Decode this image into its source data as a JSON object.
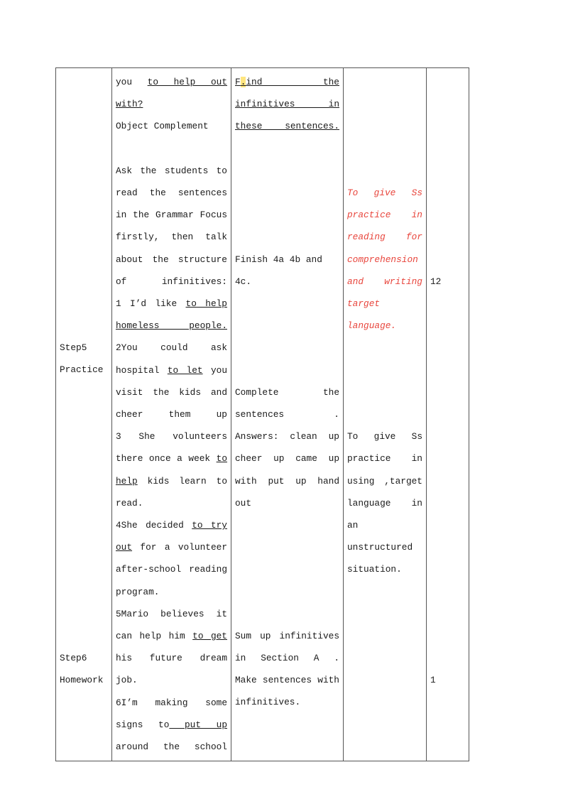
{
  "document": {
    "type": "lesson-plan-table",
    "columns": [
      "stage",
      "teacher-procedure",
      "student-activity",
      "purpose",
      "time"
    ]
  },
  "rows": [
    {
      "stage": "",
      "procedure": [
        "you to help out with?",
        "Object Complement",
        "",
        "Ask the students to read the sentences in the Grammar Focus firstly, then talk about the structure of infinitives:",
        "1 I’d like to help homeless people.",
        "2You could ask hospital to let you visit the kids and cheer them up",
        "3 She volunteers there once a week to help kids learn to read.",
        "4She decided to try out for a volunteer after-school reading program.",
        "5Mario believes it can help him to get his future dream job."
      ],
      "activity": [
        "Find the infinitives in these sentences.",
        "Finish 4a 4b and 4c.",
        "Complete the sentences .",
        "Answers: clean up cheer up came up with put up hand out",
        "Sum up infinitives in Section A .",
        "Make sentences with infinitives."
      ],
      "purpose_red": "To give Ss practice in reading for comprehension and writing target language.",
      "purpose_plain": "To give Ss practice in using ,target language in an unstructured situation.",
      "time_top": "12",
      "time_bottom": "1"
    }
  ],
  "stage_labels": {
    "step5": "Step5",
    "step5_sub": "Practice",
    "step6": "Step6",
    "step6_sub": "Homework"
  },
  "procedure_lines": {
    "l1_a": "you ",
    "l1_b": "to help out with?",
    "l2": "Object Complement",
    "l4": "Ask the students to read the sentences in the Grammar Focus firstly, then talk about the structure of infinitives:",
    "l5_a": "1 I’d like ",
    "l5_b": "to help homeless people.",
    "l6_a": "2You could ask hospital ",
    "l6_b": "to let",
    "l6_c": " you visit the kids and cheer them up",
    "l7_a": "3 She volunteers there once a week ",
    "l7_b": "to help",
    "l7_c": " kids learn to read.",
    "l8_a": "4She decided ",
    "l8_b": "to try out",
    "l8_c": " for a volunteer after-school reading program.",
    "l9_a": "5Mario believes it can help him ",
    "l9_b": "to get",
    "l9_c": " his future dream job.",
    "l10_a": "6I’m making some signs to",
    "l10_b": "  put up",
    "l10_c": " around the school"
  },
  "activity_lines": {
    "a1_f": "F",
    "a1_dot": ".",
    "a1_rest": "ind the infinitives in these sentences. ",
    "a2": "Finish 4a 4b and 4c.",
    "a3": "Complete the sentences .",
    "a4": "Answers: clean up cheer up came up with put up hand out",
    "a5": "Sum up infinitives in Section A .",
    "a6": "    Make sentences with infinitives."
  },
  "purpose_lines": {
    "red": "To give Ss practice in reading for comprehension and writing target language.",
    "plain": "To give Ss practice in using ,target language in an unstructured situation."
  },
  "time_values": {
    "top": "12",
    "bottom": "1"
  },
  "colors": {
    "red_accent": "#e8453c",
    "border": "#555555",
    "text": "#1a1a1a",
    "highlight": "#ffe680"
  }
}
